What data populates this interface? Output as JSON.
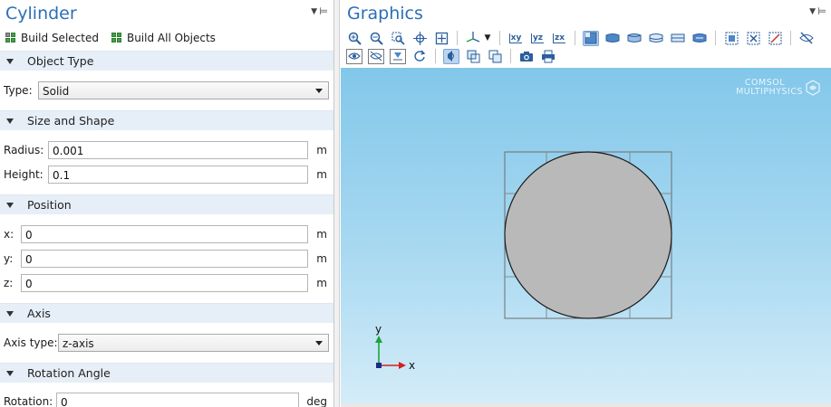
{
  "settings": {
    "title": "Cylinder",
    "build_selected": "Build Selected",
    "build_all": "Build All Objects",
    "object_type": {
      "section": "Object Type",
      "type_label": "Type:",
      "type_value": "Solid"
    },
    "size_shape": {
      "section": "Size and Shape",
      "radius_label": "Radius:",
      "radius_value": "0.001",
      "radius_unit": "m",
      "height_label": "Height:",
      "height_value": "0.1",
      "height_unit": "m"
    },
    "position": {
      "section": "Position",
      "x_label": "x:",
      "x_value": "0",
      "x_unit": "m",
      "y_label": "y:",
      "y_value": "0",
      "y_unit": "m",
      "z_label": "z:",
      "z_value": "0",
      "z_unit": "m"
    },
    "axis": {
      "section": "Axis",
      "axis_type_label": "Axis type:",
      "axis_type_value": "z-axis"
    },
    "rotation": {
      "section": "Rotation Angle",
      "rotation_label": "Rotation:",
      "rotation_value": "0",
      "rotation_unit": "deg"
    }
  },
  "graphics": {
    "title": "Graphics",
    "logo_line1": "COMSOL",
    "logo_line2": "MULTIPHYSICS",
    "axis_y": "y",
    "axis_x": "x",
    "toolbar_labels": {
      "xy": "xy",
      "yz": "yz",
      "zx": "zx"
    },
    "colors": {
      "circle_fill": "#b9b9b9",
      "axis_y": "#1fa33a",
      "axis_x": "#d42020",
      "title": "#2c6fb6"
    }
  }
}
